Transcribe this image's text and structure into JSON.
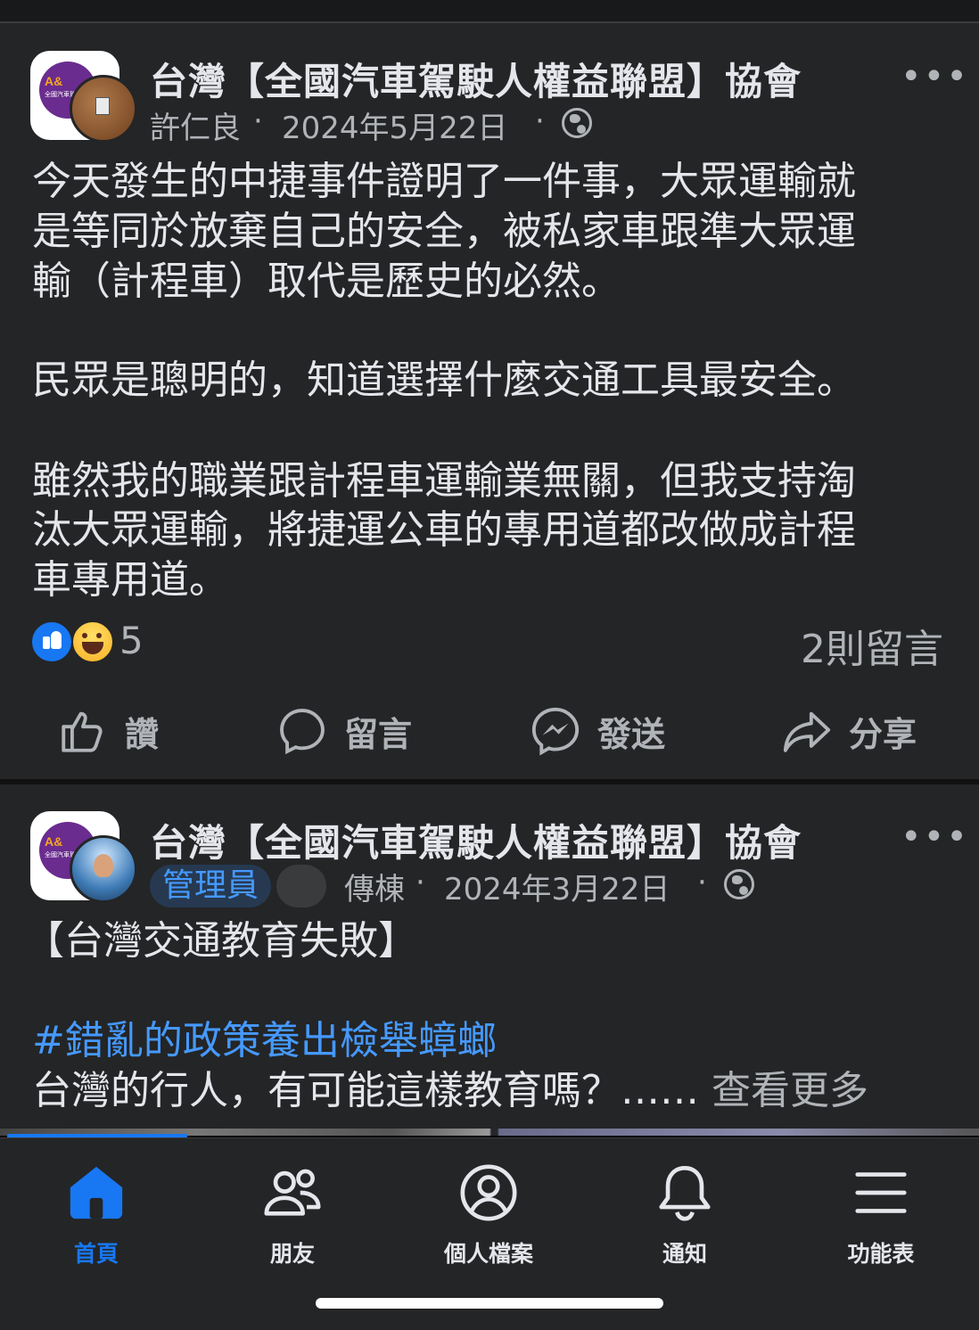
{
  "colors": {
    "background": "#242526",
    "text": "#e4e6eb",
    "muted": "#b0b3b8",
    "accent": "#1877f2",
    "hashtag": "#4599ff"
  },
  "posts": [
    {
      "group_name": "台灣【全國汽車駕駛人權益聯盟】協會",
      "author": "許仁良",
      "separator": "·",
      "date": "2024年5月22日",
      "privacy_icon": "globe-icon",
      "body_lines": [
        "今天發生的中捷事件證明了一件事，大眾運輸就",
        "是等同於放棄自己的安全，被私家車跟準大眾運",
        "輸（計程車）取代是歷史的必然。",
        "民眾是聰明的，知道選擇什麼交通工具最安全。",
        "雖然我的職業跟計程車運輸業無關，但我支持淘",
        "汰大眾運輸，將捷運公車的專用道都改做成計程",
        "車專用道。"
      ],
      "reaction_count": "5",
      "comment_count": "2則留言",
      "actions": {
        "like": "讚",
        "comment": "留言",
        "send": "發送",
        "share": "分享"
      }
    },
    {
      "group_name": "台灣【全國汽車駕駛人權益聯盟】協會",
      "badge": "管理員",
      "author": "傳棟",
      "separator": "·",
      "date": "2024年3月22日",
      "privacy_icon": "globe-icon",
      "body_title": "【台灣交通教育失敗】",
      "hashtag": "#錯亂的政策養出檢舉蟑螂",
      "body_last": "台灣的行人，有可能這樣教育嗎？……",
      "see_more": "查看更多"
    }
  ],
  "avatar_text": {
    "initials": "A&",
    "sub": "全國汽車駕 Righ"
  },
  "nav": [
    {
      "label": "首頁",
      "icon": "home-icon",
      "active": true
    },
    {
      "label": "朋友",
      "icon": "friends-icon",
      "active": false
    },
    {
      "label": "個人檔案",
      "icon": "profile-icon",
      "active": false
    },
    {
      "label": "通知",
      "icon": "bell-icon",
      "active": false
    },
    {
      "label": "功能表",
      "icon": "menu-icon",
      "active": false
    }
  ]
}
